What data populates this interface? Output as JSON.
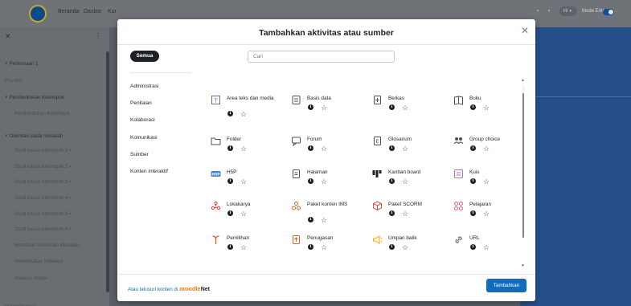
{
  "background": {
    "nav": [
      "Beranda",
      "Dasbor",
      "Kur"
    ],
    "top_right_badge": "FF",
    "edit_mode_label": "Mode Edit",
    "drawer_items": [
      {
        "label": "Pertemuan 1",
        "level": 0,
        "chevron": true
      },
      {
        "label": "Pre-test",
        "level": 1
      },
      {
        "label": "Pembentukan Kelompok",
        "level": 0,
        "chevron": true
      },
      {
        "label": "Pembentukan Kelompok",
        "level": 2
      },
      {
        "label": "Orientasi pada masalah",
        "level": 0,
        "chevron": true
      },
      {
        "label": "Studi kasus kelompok 1",
        "level": 2,
        "lock": true
      },
      {
        "label": "Studi kasus kelompok 2",
        "level": 2,
        "lock": true
      },
      {
        "label": "Studi kasus kelompok 3",
        "level": 2,
        "lock": true
      },
      {
        "label": "Studi kasus kelompok 4",
        "level": 2,
        "lock": true
      },
      {
        "label": "Studi kasus kelompok 5",
        "level": 2,
        "lock": true
      },
      {
        "label": "Studi kasus kelompok 6",
        "level": 2,
        "lock": true
      },
      {
        "label": "Membuat Rumusan Masalah",
        "level": 2
      },
      {
        "label": "Menentukan Indikator",
        "level": 2
      },
      {
        "label": "Analisis Solusi",
        "level": 2
      },
      {
        "label": "Pengumuman",
        "level": 1
      }
    ]
  },
  "modal": {
    "title": "Tambahkan aktivitas atau sumber",
    "all_tab": "Semua",
    "search_placeholder": "Cari",
    "categories": [
      "Administrasi",
      "Penilaian",
      "Kolaborasi",
      "Komunikasi",
      "Sumber",
      "Konten interaktif"
    ],
    "activities": [
      {
        "name": "Area teks dan media",
        "icon": "text-media-icon",
        "color": "#5b6fb7"
      },
      {
        "name": "Basis data",
        "icon": "database-icon",
        "color": "#4d5155"
      },
      {
        "name": "Berkas",
        "icon": "file-icon",
        "color": "#4d5155"
      },
      {
        "name": "Buku",
        "icon": "book-icon",
        "color": "#4d5155"
      },
      {
        "name": "Folder",
        "icon": "folder-icon",
        "color": "#4d5155"
      },
      {
        "name": "Forum",
        "icon": "forum-icon",
        "color": "#4d5155"
      },
      {
        "name": "Glosarium",
        "icon": "glossary-icon",
        "color": "#4d5155"
      },
      {
        "name": "Group choice",
        "icon": "group-choice-icon",
        "color": "#4d5155"
      },
      {
        "name": "H5P",
        "icon": "h5p-icon",
        "color": "#3c84d6"
      },
      {
        "name": "Halaman",
        "icon": "page-icon",
        "color": "#4d5155"
      },
      {
        "name": "Kanban board",
        "icon": "kanban-icon",
        "color": "#1d2125"
      },
      {
        "name": "Kuis",
        "icon": "quiz-icon",
        "color": "#d35ad2"
      },
      {
        "name": "Lokakarya",
        "icon": "workshop-icon",
        "color": "#e8453c"
      },
      {
        "name": "Paket konten IMS",
        "icon": "ims-package-icon",
        "color": "#cf6a17"
      },
      {
        "name": "Paket SCORM",
        "icon": "scorm-icon",
        "color": "#d94b3a"
      },
      {
        "name": "Pelajaran",
        "icon": "lesson-icon",
        "color": "#e85a7a"
      },
      {
        "name": "Pemilihan",
        "icon": "choice-icon",
        "color": "#e0602b"
      },
      {
        "name": "Penugasan",
        "icon": "assignment-icon",
        "color": "#e0602b"
      },
      {
        "name": "Umpan balik",
        "icon": "feedback-icon",
        "color": "#f0a800"
      },
      {
        "name": "URL",
        "icon": "url-icon",
        "color": "#4d5155"
      }
    ],
    "footer_prefix": "Atau telusuri konten di ",
    "footer_brand_moodle": "moodle",
    "footer_brand_net": "Net",
    "add_button": "Tambahkan"
  }
}
